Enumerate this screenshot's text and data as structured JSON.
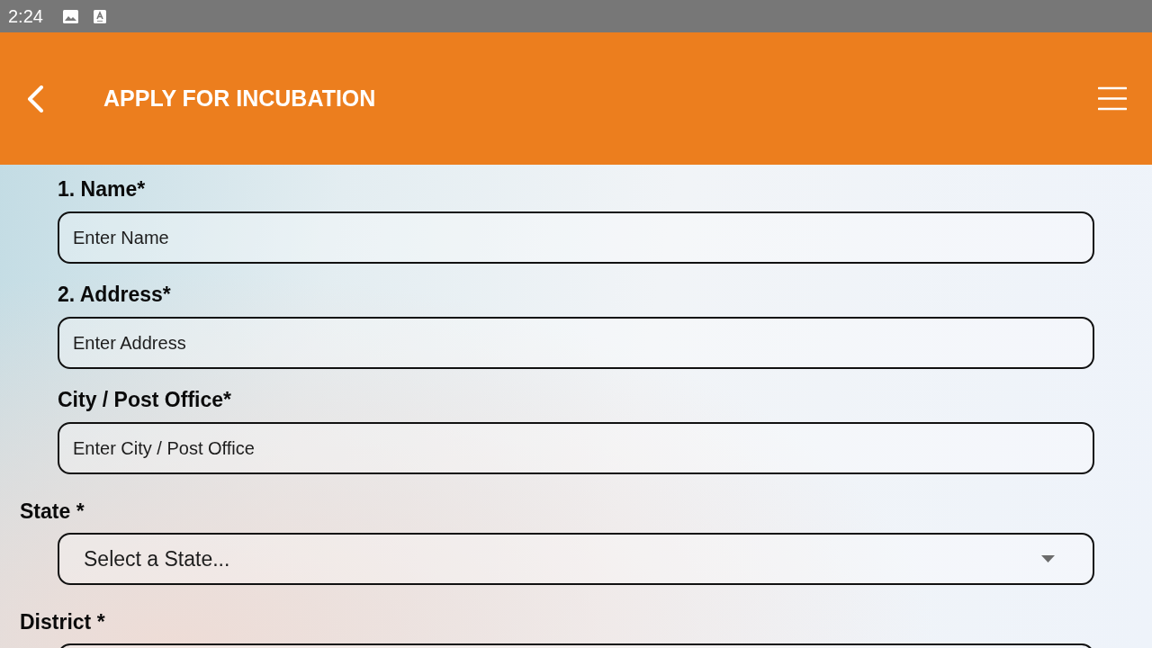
{
  "status_bar": {
    "time": "2:24"
  },
  "header": {
    "title": "APPLY FOR INCUBATION"
  },
  "form": {
    "fields": [
      {
        "kind": "text",
        "label": "1. Name*",
        "placeholder": "Enter Name"
      },
      {
        "kind": "text",
        "label": "2. Address*",
        "placeholder": "Enter Address"
      },
      {
        "kind": "text",
        "label": "City / Post Office*",
        "placeholder": "Enter City / Post Office"
      },
      {
        "kind": "select",
        "label": "State *",
        "placeholder": "Select a State..."
      },
      {
        "kind": "select",
        "label": "District *"
      }
    ]
  }
}
